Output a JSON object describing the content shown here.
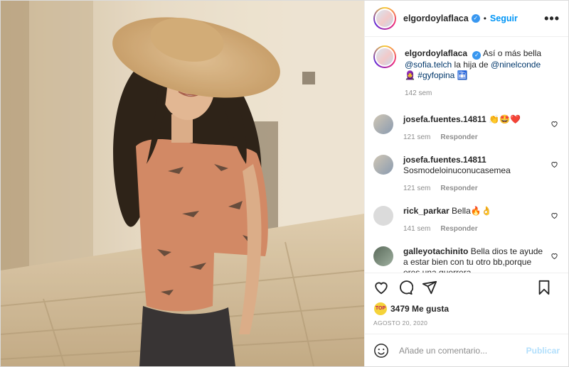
{
  "post": {
    "author": "elgordoylaflaca",
    "follow_label": "Seguir",
    "dot": "•",
    "more_label": "•••",
    "image_alt_icon": "photo"
  },
  "caption": {
    "author": "elgordoylaflaca",
    "text_pre": "Así o más bella",
    "mention1": "@sofia.telch",
    "text_mid": " la hija de ",
    "mention2": "@ninelconde",
    "hashtag": "#gyfopina",
    "emoji1": "🧕",
    "emoji2": "🛅",
    "time": "142 sem"
  },
  "comments": [
    {
      "name": "josefa.fuentes.14811",
      "text": " 👏🤩❤️",
      "time": "121 sem",
      "reply": "Responder"
    },
    {
      "name": "josefa.fuentes.14811",
      "text": "Sosmodeloinuconucasemea",
      "time": "121 sem",
      "reply": "Responder"
    },
    {
      "name": "rick_parkar",
      "text": " Bella🔥👌",
      "time": "141 sem",
      "reply": "Responder"
    },
    {
      "name": "galleyotachinito",
      "text": " Bella dios te ayude a estar bien con tu otro bb,porque eres una guerrera",
      "time": "",
      "reply": ""
    }
  ],
  "likes": {
    "count": "3479 Me gusta",
    "avatar_text": "TOP"
  },
  "date": "AGOSTO 20, 2020",
  "composer": {
    "placeholder": "Añade un comentario...",
    "publish_label": "Publicar"
  },
  "colors": {
    "accent": "#0095f6",
    "verified": "#3897f0",
    "heart_red": "#ed4956"
  }
}
